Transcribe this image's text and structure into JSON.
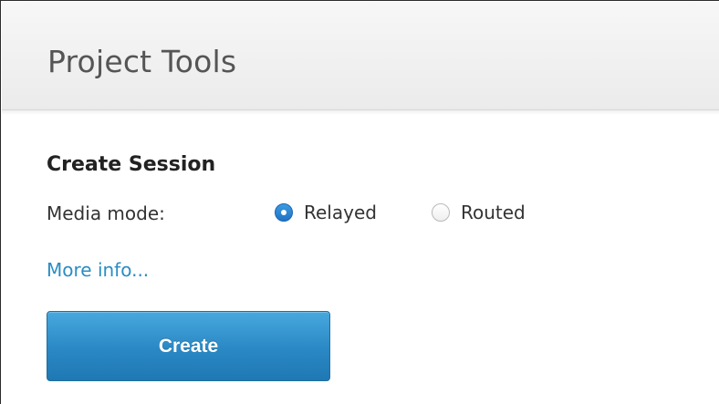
{
  "panel": {
    "title": "Project Tools"
  },
  "session": {
    "heading": "Create Session",
    "media_mode_label": "Media mode:",
    "options": [
      {
        "label": "Relayed",
        "selected": true
      },
      {
        "label": "Routed",
        "selected": false
      }
    ],
    "more_info_link": "More info...",
    "create_button": "Create"
  },
  "colors": {
    "accent": "#2a88c4",
    "link": "#2a8dc4",
    "radio_selected": "#1f73c4"
  }
}
